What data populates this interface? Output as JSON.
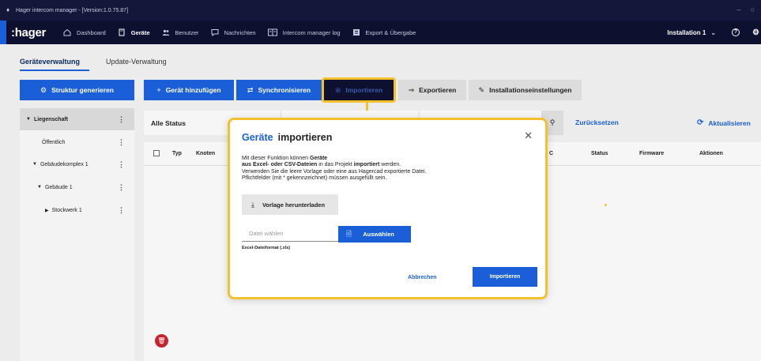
{
  "titlebar": {
    "title": "Hager intercom manager - [Version:1.0.75.87]"
  },
  "navbar": {
    "brand": ":hager",
    "items": [
      {
        "label": "Dashboard",
        "icon": "home-icon",
        "active": false
      },
      {
        "label": "Geräte",
        "icon": "device-icon",
        "active": true
      },
      {
        "label": "Benutzer",
        "icon": "users-icon",
        "active": false
      },
      {
        "label": "Nachrichten",
        "icon": "message-icon",
        "active": false
      },
      {
        "label": "Intercom manager log",
        "icon": "log-icon",
        "active": false
      },
      {
        "label": "Export & Übergabe",
        "icon": "export-icon",
        "active": false
      }
    ],
    "installation": "Installation 1"
  },
  "tabs": [
    {
      "label": "Geräteverwaltung",
      "active": true
    },
    {
      "label": "Update-Verwaltung",
      "active": false
    }
  ],
  "toolbar": {
    "generate": "Struktur generieren",
    "add_device": "Gerät hinzufügen",
    "sync": "Synchronisieren",
    "import": "Importieren",
    "export": "Exportieren",
    "settings": "Installationseinstellungen"
  },
  "tree": [
    {
      "label": "Liegenschaft",
      "indent": 0,
      "expanded": true,
      "selected": true
    },
    {
      "label": "Öffentlich",
      "indent": 1,
      "expanded": null,
      "selected": false
    },
    {
      "label": "Gebäudekomplex 1",
      "indent": 1,
      "expanded": true,
      "selected": false
    },
    {
      "label": "Gebäude 1",
      "indent": 2,
      "expanded": true,
      "selected": false
    },
    {
      "label": "Stockwerk 1",
      "indent": 3,
      "expanded": false,
      "selected": false
    }
  ],
  "filter": {
    "status": "Alle Status",
    "reset": "Zurücksetzen",
    "refresh": "Aktualisieren"
  },
  "table": {
    "columns": [
      "Typ",
      "Knoten",
      "C",
      "Status",
      "Firmware",
      "Aktionen"
    ]
  },
  "modal": {
    "title_accent": "Geräte",
    "title_rest": "importieren",
    "desc_line1_pre": "Mit dieser Funktion können ",
    "desc_line1_bold": "Geräte",
    "desc_line2_bold": "aus Excel- oder CSV-Dateien",
    "desc_line2_mid": " in das Projekt ",
    "desc_line2_bold2": "importiert",
    "desc_line2_post": " werden.",
    "desc_line3": "Verwenden Sie die leere Vorlage oder eine aus Hagercad exportierte Datei.",
    "desc_line4": "Pflichtfelder (mit * gekennzeichnet) müssen ausgefüllt sein.",
    "download": "Vorlage herunterladen",
    "file_placeholder": "Datei wählen",
    "pick": "Auswählen",
    "format_note": "Excel-Dateiformat (.xls)",
    "cancel": "Abbrechen",
    "confirm": "Importieren"
  },
  "colors": {
    "accent": "#1a5fd8",
    "highlight": "#f3c12b",
    "nav_bg": "#0e1030",
    "danger": "#c42530"
  }
}
